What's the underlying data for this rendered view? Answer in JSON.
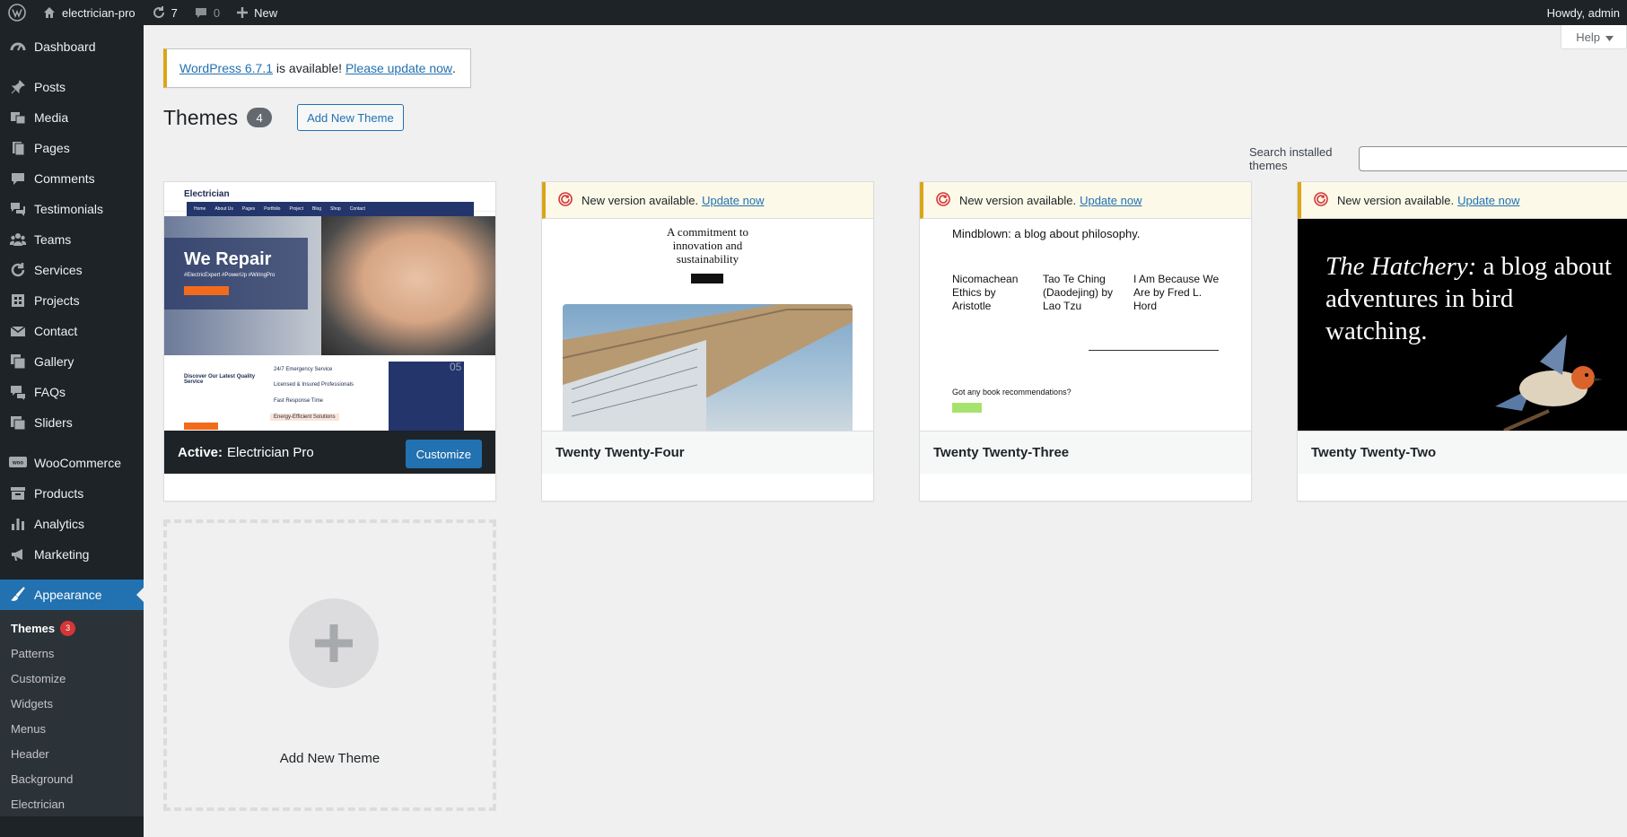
{
  "adminbar": {
    "site_name": "electrician-pro",
    "updates_count": "7",
    "comments_count": "0",
    "new_label": "New",
    "howdy": "Howdy, admin"
  },
  "sidebar": {
    "items": [
      {
        "label": "Dashboard",
        "icon": "dashboard-icon"
      },
      {
        "label": "Posts",
        "icon": "pin-icon"
      },
      {
        "label": "Media",
        "icon": "media-icon"
      },
      {
        "label": "Pages",
        "icon": "pages-icon"
      },
      {
        "label": "Comments",
        "icon": "comment-icon"
      },
      {
        "label": "Testimonials",
        "icon": "testimonial-icon"
      },
      {
        "label": "Teams",
        "icon": "groups-icon"
      },
      {
        "label": "Services",
        "icon": "services-icon"
      },
      {
        "label": "Projects",
        "icon": "projects-icon"
      },
      {
        "label": "Contact",
        "icon": "email-icon"
      },
      {
        "label": "Gallery",
        "icon": "gallery-icon"
      },
      {
        "label": "FAQs",
        "icon": "faq-icon"
      },
      {
        "label": "Sliders",
        "icon": "slides-icon"
      },
      {
        "label": "WooCommerce",
        "icon": "woo-icon"
      },
      {
        "label": "Products",
        "icon": "archive-icon"
      },
      {
        "label": "Analytics",
        "icon": "chart-bar-icon"
      },
      {
        "label": "Marketing",
        "icon": "megaphone-icon"
      },
      {
        "label": "Appearance",
        "icon": "brush-icon"
      }
    ],
    "submenu": [
      {
        "label": "Themes",
        "badge": "3"
      },
      {
        "label": "Patterns"
      },
      {
        "label": "Customize"
      },
      {
        "label": "Widgets"
      },
      {
        "label": "Menus"
      },
      {
        "label": "Header"
      },
      {
        "label": "Background"
      },
      {
        "label": "Electrician"
      }
    ]
  },
  "help_label": "Help",
  "notice": {
    "version_link": "WordPress 6.7.1",
    "text": " is available! ",
    "update_link": "Please update now",
    "end": "."
  },
  "page": {
    "title": "Themes",
    "count": "4",
    "add_new_button": "Add New Theme",
    "search_label": "Search installed themes",
    "search_value": ""
  },
  "themes": {
    "active": {
      "prefix": "Active:",
      "name": "Electrician Pro",
      "customize": "Customize",
      "shot": {
        "logo": "Electrician",
        "nav": [
          "Home",
          "About Us",
          "Pages",
          "Portfolio",
          "Project",
          "Blog",
          "Shop",
          "Contact"
        ],
        "hero_title": "We Repair",
        "hero_tags": "#ElectricExpert #PowerUp #WiringPro",
        "bottom_left_title": "Discover Our Latest Quality Service",
        "features": [
          "24/7 Emergency Service",
          "Licensed & Insured Professionals",
          "Fast Response Time",
          "Energy-Efficient Solutions"
        ],
        "box_number": "05"
      }
    },
    "t24": {
      "name": "Twenty Twenty-Four",
      "update_text": "New version available.",
      "update_link": "Update now",
      "shot_title": "A commitment to innovation and sustainability"
    },
    "t23": {
      "name": "Twenty Twenty-Three",
      "update_text": "New version available.",
      "update_link": "Update now",
      "shot_title": "Mindblown: a blog about philosophy.",
      "posts": [
        "Nicomachean Ethics by Aristotle",
        "Tao Te Ching (Daodejing) by Lao Tzu",
        "I Am Because We Are by Fred L. Hord"
      ],
      "question": "Got any book recommendations?"
    },
    "t22": {
      "name": "Twenty Twenty-Two",
      "update_text": "New version available.",
      "update_link": "Update now",
      "shot_title_italic": "The Hatchery:",
      "shot_title_rest": " a blog about adventures in bird watching."
    }
  },
  "add_new_card": {
    "label": "Add New Theme"
  },
  "colors": {
    "admin_dark": "#1d2327",
    "accent": "#2271b1",
    "warning": "#dba617",
    "badge_red": "#d63638"
  }
}
